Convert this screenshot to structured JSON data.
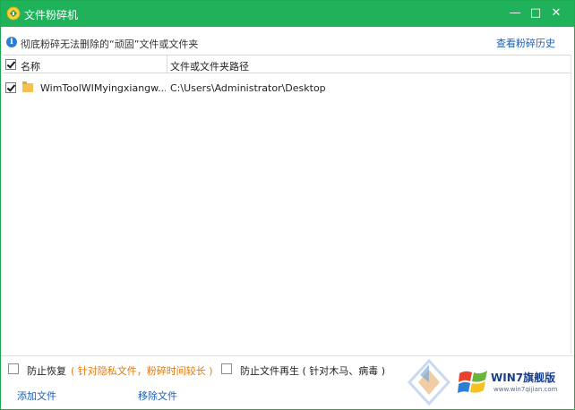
{
  "window": {
    "title": "文件粉碎机",
    "minimize_glyph": "—",
    "maximize_glyph": "□",
    "close_glyph": "✕"
  },
  "infobar": {
    "icon": "info-icon",
    "icon_glyph": "i",
    "text": "彻底粉碎无法删除的“顽固”文件或文件夹",
    "history_link": "查看粉碎历史"
  },
  "list": {
    "header": {
      "name": "名称",
      "path": "文件或文件夹路径",
      "all_checked": true
    },
    "rows": [
      {
        "checked": true,
        "icon": "folder-icon",
        "name": "WimToolWIMyingxiangw...",
        "path": "C:\\Users\\Administrator\\Desktop"
      }
    ]
  },
  "options": {
    "prevent_recovery_label": "防止恢复",
    "prevent_recovery_note": "( 针对隐私文件，粉碎时间较长 )",
    "prevent_recovery_checked": false,
    "prevent_regen_label": "防止文件再生 ( 针对木马、病毒 )",
    "prevent_regen_checked": false
  },
  "footer": {
    "add_label": "添加文件",
    "remove_label": "移除文件"
  },
  "watermark": {
    "text": "WIN7旗舰版",
    "url": "www.win7qijian.com"
  },
  "colors": {
    "titlebar": "#1fb25a",
    "link": "#1a5fb4",
    "note": "#e07a10"
  }
}
